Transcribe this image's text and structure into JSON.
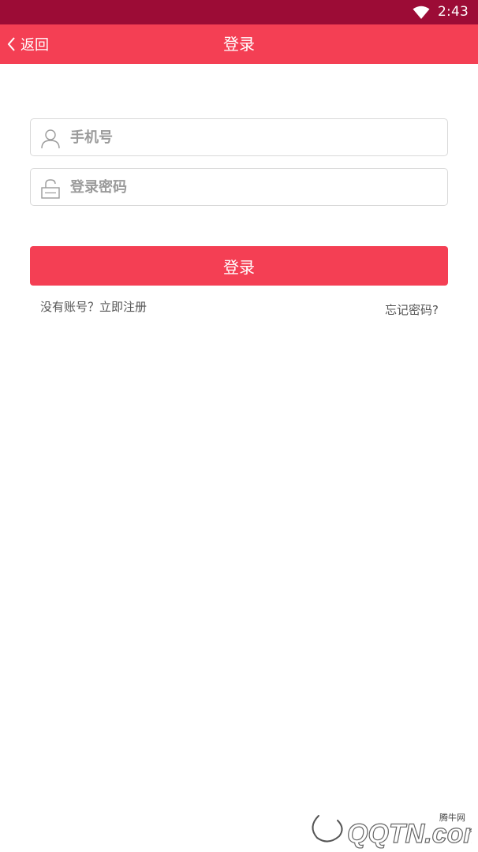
{
  "status_bar": {
    "time": "2:43",
    "wifi_icon": "wifi-icon",
    "background": "#9c0c36"
  },
  "header": {
    "back_label": "返回",
    "back_icon": "chevron-left-icon",
    "title": "登录",
    "background": "#f43f54"
  },
  "form": {
    "phone": {
      "placeholder": "手机号",
      "icon": "user-icon"
    },
    "password": {
      "placeholder": "登录密码",
      "icon": "lock-icon"
    },
    "login_button_label": "登录",
    "register_link": "没有账号？立即注册",
    "forgot_link": "忘记密码?"
  },
  "watermark": {
    "site": "腾牛网",
    "logo_text": "QQTN.com"
  },
  "colors": {
    "accent": "#f43f54",
    "border": "#d9d9d9",
    "placeholder": "#9b9b9b"
  }
}
